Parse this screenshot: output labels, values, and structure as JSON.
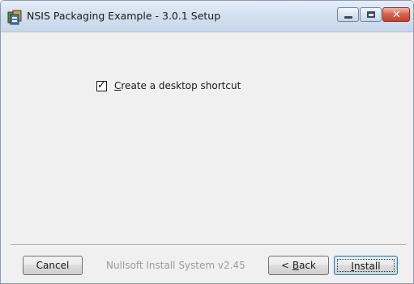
{
  "window": {
    "title": "NSIS Packaging Example - 3.0.1 Setup",
    "icons": {
      "app": "installer-icon",
      "minimize": "minimize-icon",
      "maximize": "maximize-icon",
      "close": "close-icon"
    },
    "close_color": "#c2412b"
  },
  "options": {
    "desktop_shortcut": {
      "label_mnemonic": "C",
      "label_rest": "reate a desktop shortcut",
      "checked": true
    }
  },
  "footer": {
    "branding": "Nullsoft Install System v2.45",
    "cancel_label": "Cancel",
    "back_prefix": "< ",
    "back_mnemonic": "B",
    "back_rest": "ack",
    "install_mnemonic": "I",
    "install_rest": "nstall"
  }
}
